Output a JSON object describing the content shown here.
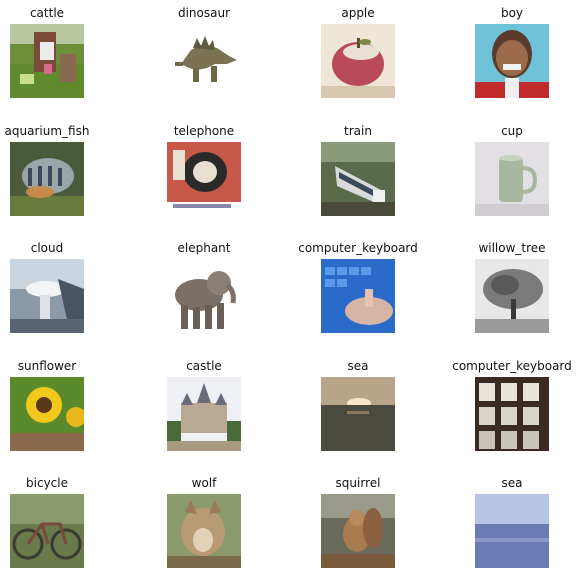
{
  "tiles": [
    {
      "label": "cattle",
      "icon": "cattle-image"
    },
    {
      "label": "dinosaur",
      "icon": "dinosaur-image"
    },
    {
      "label": "apple",
      "icon": "apple-image"
    },
    {
      "label": "boy",
      "icon": "boy-image"
    },
    {
      "label": "aquarium_fish",
      "icon": "aquarium-fish-image"
    },
    {
      "label": "telephone",
      "icon": "telephone-image"
    },
    {
      "label": "train",
      "icon": "train-image"
    },
    {
      "label": "cup",
      "icon": "cup-image"
    },
    {
      "label": "cloud",
      "icon": "cloud-image"
    },
    {
      "label": "elephant",
      "icon": "elephant-image"
    },
    {
      "label": "computer_keyboard",
      "icon": "computer-keyboard-image"
    },
    {
      "label": "willow_tree",
      "icon": "willow-tree-image"
    },
    {
      "label": "sunflower",
      "icon": "sunflower-image"
    },
    {
      "label": "castle",
      "icon": "castle-image"
    },
    {
      "label": "sea",
      "icon": "sea-image"
    },
    {
      "label": "computer_keyboard",
      "icon": "computer-keyboard-image"
    },
    {
      "label": "bicycle",
      "icon": "bicycle-image"
    },
    {
      "label": "wolf",
      "icon": "wolf-image"
    },
    {
      "label": "squirrel",
      "icon": "squirrel-image"
    },
    {
      "label": "sea",
      "icon": "sea-image"
    }
  ]
}
